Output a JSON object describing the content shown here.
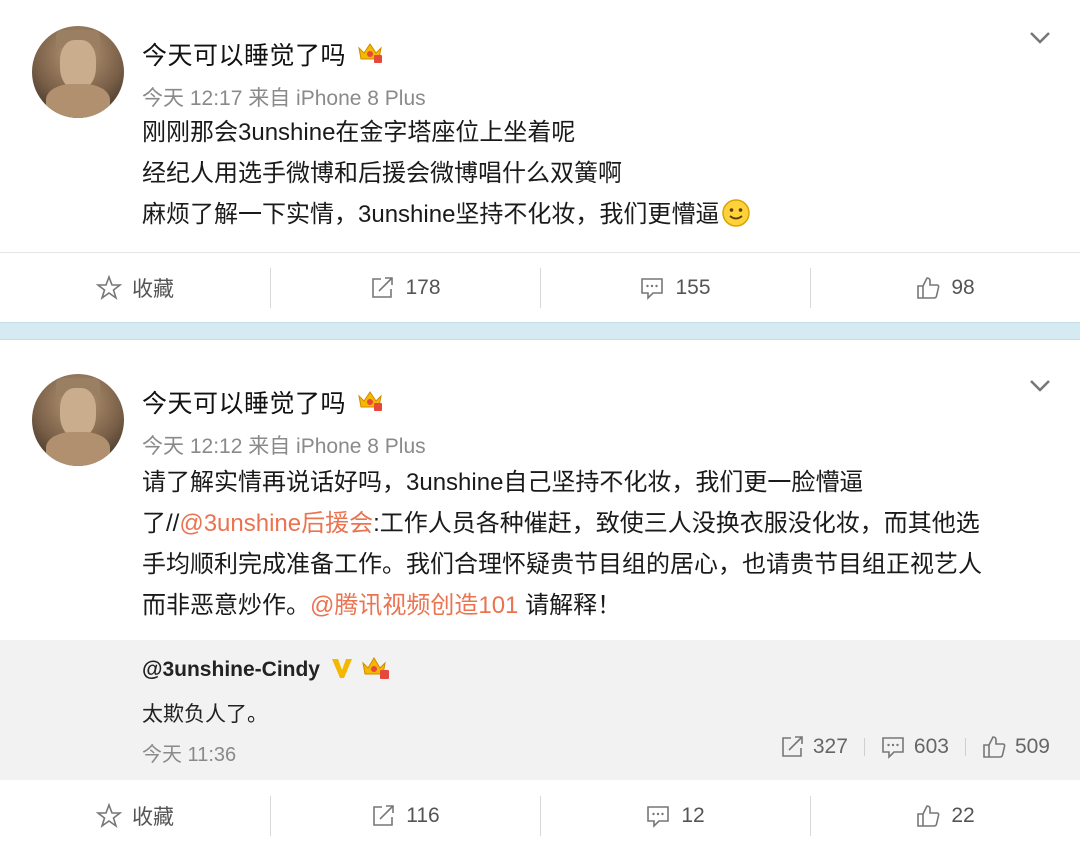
{
  "posts": [
    {
      "username": "今天可以睡觉了吗",
      "meta": "今天 12:17 来自 iPhone 8 Plus",
      "lines": [
        "刚刚那会3unshine在金字塔座位上坐着呢",
        "经纪人用选手微博和后援会微博唱什么双簧啊",
        "麻烦了解一下实情，3unshine坚持不化妆，我们更懵逼"
      ],
      "actions": {
        "fav": "收藏",
        "repost": "178",
        "comment": "155",
        "like": "98"
      }
    },
    {
      "username": "今天可以睡觉了吗",
      "meta": "今天 12:12 来自 iPhone 8 Plus",
      "lines": [
        "请了解实情再说话好吗，3unshine自己坚持不化妆，我们更一脸懵逼",
        "了//",
        "@3unshine后援会",
        ":工作人员各种催赶，致使三人没换衣服没化妆，而其他选",
        "手均顺利完成准备工作。我们合理怀疑贵节目组的居心，也请贵节目组正视艺人",
        "而非恶意炒作。",
        "@腾讯视频创造101",
        " 请解释！"
      ],
      "quote": {
        "user": "@3unshine-Cindy",
        "text": "太欺负人了。",
        "time": "今天 11:36",
        "repost": "327",
        "comment": "603",
        "like": "509"
      },
      "actions": {
        "fav": "收藏",
        "repost": "116",
        "comment": "12",
        "like": "22"
      }
    }
  ],
  "colors": {
    "mention": "#eb7350",
    "divider": "#d6eaf2",
    "quote_bg": "#f2f2f2"
  },
  "icons": [
    "crown-icon",
    "chevron-down-icon",
    "smile-icon",
    "star-icon",
    "repost-icon",
    "comment-icon",
    "like-icon",
    "verified-v-icon"
  ]
}
